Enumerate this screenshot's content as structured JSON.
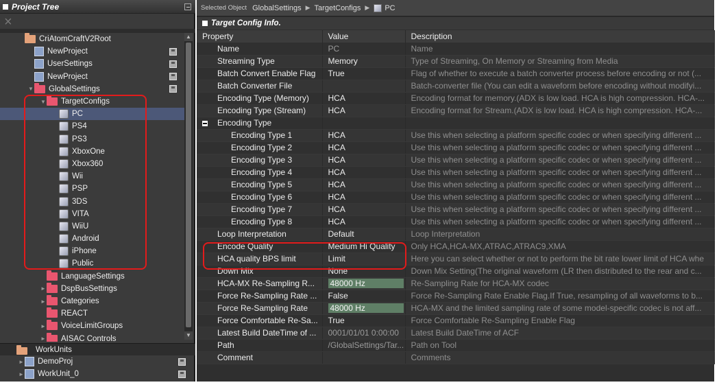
{
  "project_tree": {
    "title": "Project Tree",
    "close_glyph": "×",
    "items": [
      {
        "label": "CriAtomCraftV2Root",
        "indent": 0,
        "icon": "folder",
        "arrow": ""
      },
      {
        "label": "NewProject",
        "indent": 1,
        "icon": "doc",
        "save": true
      },
      {
        "label": "UserSettings",
        "indent": 1,
        "icon": "doc",
        "save": true
      },
      {
        "label": "NewProject",
        "indent": 1,
        "icon": "doc",
        "save": true
      },
      {
        "label": "GlobalSettings",
        "indent": 1,
        "icon": "folder-red",
        "arrow": "▼",
        "save": true
      },
      {
        "label": "TargetConfigs",
        "indent": 2,
        "icon": "folder-red",
        "arrow": "▼"
      },
      {
        "label": "PC",
        "indent": 3,
        "icon": "pc",
        "selected": true
      },
      {
        "label": "PS4",
        "indent": 3,
        "icon": "pc"
      },
      {
        "label": "PS3",
        "indent": 3,
        "icon": "pc"
      },
      {
        "label": "XboxOne",
        "indent": 3,
        "icon": "pc"
      },
      {
        "label": "Xbox360",
        "indent": 3,
        "icon": "pc"
      },
      {
        "label": "Wii",
        "indent": 3,
        "icon": "pc"
      },
      {
        "label": "PSP",
        "indent": 3,
        "icon": "pc"
      },
      {
        "label": "3DS",
        "indent": 3,
        "icon": "pc"
      },
      {
        "label": "VITA",
        "indent": 3,
        "icon": "pc"
      },
      {
        "label": "WiiU",
        "indent": 3,
        "icon": "pc"
      },
      {
        "label": "Android",
        "indent": 3,
        "icon": "pc"
      },
      {
        "label": "iPhone",
        "indent": 3,
        "icon": "pc"
      },
      {
        "label": "Public",
        "indent": 3,
        "icon": "pc"
      },
      {
        "label": "LanguageSettings",
        "indent": 2,
        "icon": "folder-red"
      },
      {
        "label": "DspBusSettings",
        "indent": 2,
        "icon": "folder-red",
        "arrow": "►"
      },
      {
        "label": "Categories",
        "indent": 2,
        "icon": "folder-red",
        "arrow": "►"
      },
      {
        "label": "REACT",
        "indent": 2,
        "icon": "folder-red"
      },
      {
        "label": "VoiceLimitGroups",
        "indent": 2,
        "icon": "folder-red",
        "arrow": "►"
      },
      {
        "label": "AISAC Controls",
        "indent": 2,
        "icon": "folder-red",
        "arrow": "►"
      }
    ]
  },
  "work_units": {
    "title": "WorkUnits",
    "items": [
      {
        "label": "DemoProj",
        "arrow": "►"
      },
      {
        "label": "WorkUnit_0",
        "arrow": "►"
      }
    ]
  },
  "breadcrumb": {
    "prefix": "Selected Object",
    "parts": [
      "GlobalSettings",
      "TargetConfigs",
      "PC"
    ],
    "separator": "▶"
  },
  "section": {
    "title": "Target Config Info."
  },
  "table": {
    "headers": {
      "property": "Property",
      "value": "Value",
      "description": "Description"
    },
    "rows": [
      {
        "property": "Name",
        "value": "PC",
        "description": "Name",
        "indent": 1,
        "dim": true
      },
      {
        "property": "Streaming Type",
        "value": "Memory",
        "description": "Type of Streaming, On Memory or Streaming from Media",
        "indent": 1
      },
      {
        "property": "Batch Convert Enable Flag",
        "value": "True",
        "description": "Flag of whether to execute a batch converter process before encoding or not (...",
        "indent": 1
      },
      {
        "property": "Batch Converter File",
        "value": "",
        "description": "Batch-converter file (You can edit a waveform before encoding without modifyi...",
        "indent": 1
      },
      {
        "property": "Encoding Type (Memory)",
        "value": "HCA",
        "description": "Encoding format for memory.(ADX is low load. HCA is high compression. HCA-...",
        "indent": 1
      },
      {
        "property": "Encoding Type (Stream)",
        "value": "HCA",
        "description": "Encoding format for Stream.(ADX is low load. HCA is high compression. HCA-...",
        "indent": 1
      },
      {
        "property": "Encoding Type",
        "value": "",
        "description": "",
        "indent": 1,
        "group": true
      },
      {
        "property": "Encoding Type 1",
        "value": "HCA",
        "description": "Use this when selecting a platform specific codec or when specifying different ...",
        "indent": 2
      },
      {
        "property": "Encoding Type 2",
        "value": "HCA",
        "description": "Use this when selecting a platform specific codec or when specifying different ...",
        "indent": 2
      },
      {
        "property": "Encoding Type 3",
        "value": "HCA",
        "description": "Use this when selecting a platform specific codec or when specifying different ...",
        "indent": 2
      },
      {
        "property": "Encoding Type 4",
        "value": "HCA",
        "description": "Use this when selecting a platform specific codec or when specifying different ...",
        "indent": 2
      },
      {
        "property": "Encoding Type 5",
        "value": "HCA",
        "description": "Use this when selecting a platform specific codec or when specifying different ...",
        "indent": 2
      },
      {
        "property": "Encoding Type 6",
        "value": "HCA",
        "description": "Use this when selecting a platform specific codec or when specifying different ...",
        "indent": 2
      },
      {
        "property": "Encoding Type 7",
        "value": "HCA",
        "description": "Use this when selecting a platform specific codec or when specifying different ...",
        "indent": 2
      },
      {
        "property": "Encoding Type 8",
        "value": "HCA",
        "description": "Use this when selecting a platform specific codec or when specifying different ...",
        "indent": 2
      },
      {
        "property": "Loop Interpretation",
        "value": "Default",
        "description": "Loop Interpretation",
        "indent": 1
      },
      {
        "property": "Encode Quality",
        "value": "Medium Hi Quality",
        "description": "Only HCA,HCA-MX,ATRAC,ATRAC9,XMA",
        "indent": 1
      },
      {
        "property": "HCA quality BPS limit",
        "value": "Limit",
        "description": "Here you can select whether or not to perform the bit rate lower limit of HCA whe",
        "indent": 1
      },
      {
        "property": "Down Mix",
        "value": "None",
        "description": "Down Mix Setting(The original waveform (LR then distributed to the rear and c...",
        "indent": 1
      },
      {
        "property": "HCA-MX Re-Sampling R...",
        "value": "48000 Hz",
        "description": "Re-Sampling Rate for HCA-MX codec",
        "indent": 1,
        "hz": true
      },
      {
        "property": "Force Re-Sampling Rate ...",
        "value": "False",
        "description": "Force Re-Sampling Rate Enable Flag.If True, resampling of all waveforms to b...",
        "indent": 1
      },
      {
        "property": "Force Re-Sampling Rate",
        "value": "48000 Hz",
        "description": "HCA-MX and the limited sampling rate of some model-specific codec is not aff...",
        "indent": 1,
        "hz": true
      },
      {
        "property": "Force Comfortable Re-Sa...",
        "value": "True",
        "description": "Force Comfortable Re-Sampling Enable Flag",
        "indent": 1
      },
      {
        "property": "Latest Build DateTime of ...",
        "value": "0001/01/01 0:00:00",
        "description": "Latest Build DateTime of ACF",
        "indent": 1,
        "dim": true
      },
      {
        "property": "Path",
        "value": "/GlobalSettings/Tar...",
        "description": "Path on Tool",
        "indent": 1,
        "dim": true
      },
      {
        "property": "Comment",
        "value": "",
        "description": "Comments",
        "indent": 1
      }
    ]
  },
  "colors": {
    "highlight": "#e31b1b",
    "selection": "#4c5878",
    "hz_cell": "#5f7f66"
  }
}
